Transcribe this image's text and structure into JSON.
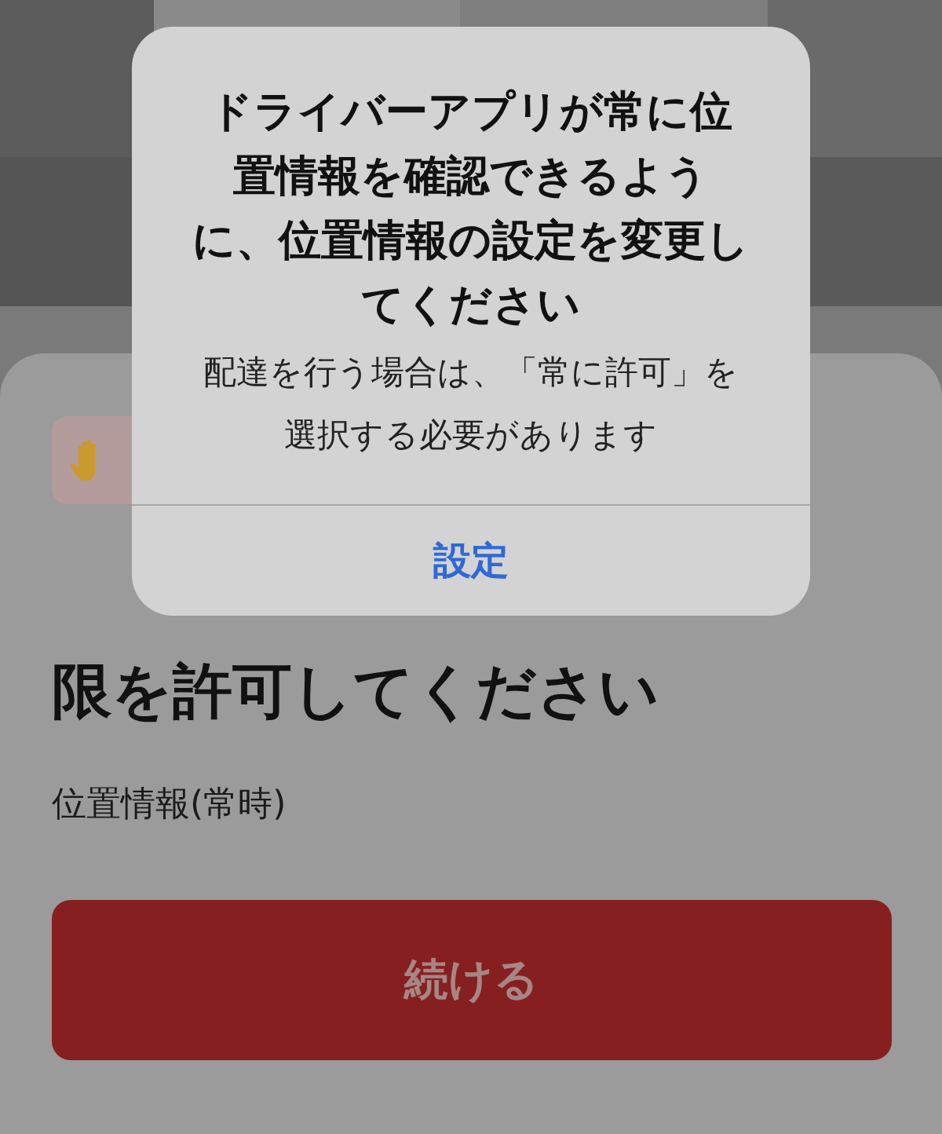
{
  "sheet": {
    "badge": {
      "kind": "hand"
    },
    "title": "限を許可してください",
    "permission": "位置情報(常時)",
    "button": {
      "label": "続ける",
      "disabled": true
    }
  },
  "alert": {
    "title": "ドライバーアプリが常に位置情報を確認できるように、位置情報の設定を変更してください",
    "message": "配達を行う場合は、「常に許可」を選択する必要があります",
    "buttons": [
      "設定"
    ]
  }
}
